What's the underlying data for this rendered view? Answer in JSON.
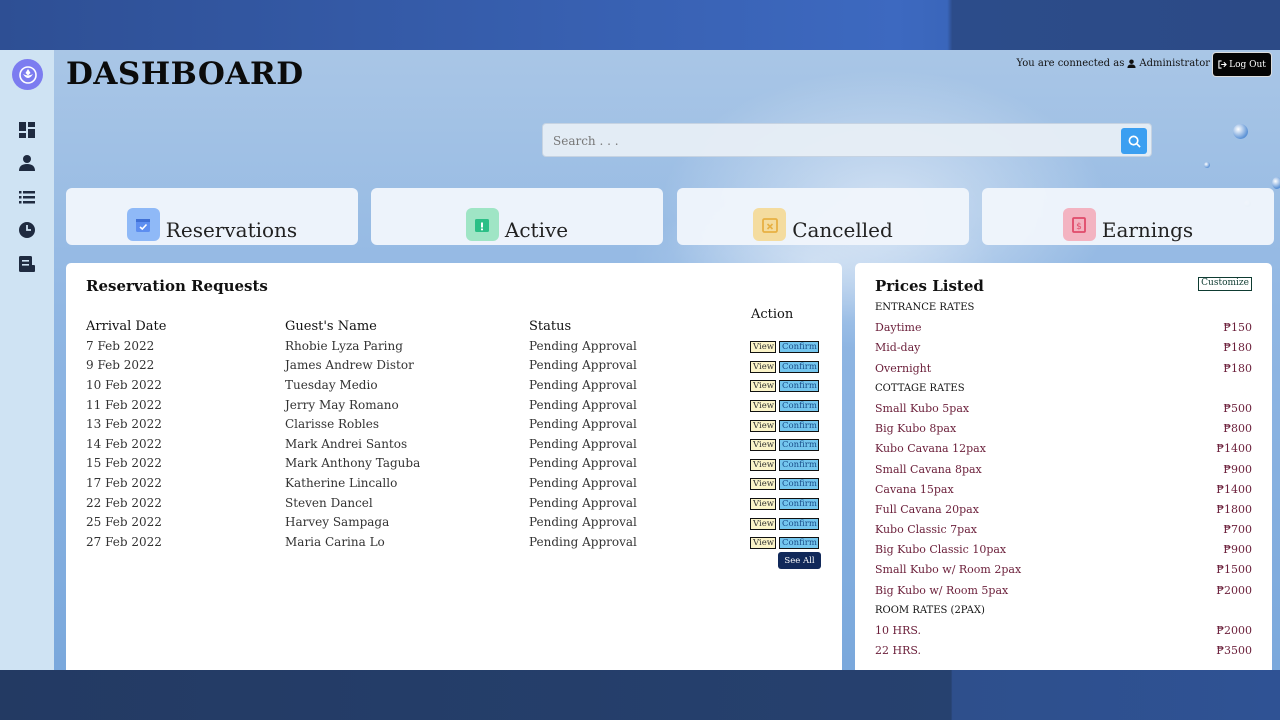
{
  "header": {
    "title": "DASHBOARD",
    "connected_prefix": "You are connected as",
    "user": "Administrator",
    "logout_label": "Log Out"
  },
  "search": {
    "placeholder": "Search . . ."
  },
  "stats": [
    {
      "label": "Reservations",
      "color": "#5d8ef0"
    },
    {
      "label": "Active",
      "color": "#2bbf86"
    },
    {
      "label": "Cancelled",
      "color": "#e7b043"
    },
    {
      "label": "Earnings",
      "color": "#e04a69"
    }
  ],
  "reservations": {
    "title": "Reservation Requests",
    "columns": {
      "date": "Arrival Date",
      "name": "Guest's Name",
      "status": "Status",
      "action": "Action"
    },
    "view_label": "View",
    "confirm_label": "Confirm",
    "see_all_label": "See All",
    "rows": [
      {
        "date": "7 Feb 2022",
        "name": "Rhobie Lyza Paring",
        "status": "Pending Approval"
      },
      {
        "date": "9 Feb 2022",
        "name": "James Andrew Distor",
        "status": "Pending Approval"
      },
      {
        "date": "10 Feb 2022",
        "name": "Tuesday Medio",
        "status": "Pending Approval"
      },
      {
        "date": "11 Feb 2022",
        "name": "Jerry May Romano",
        "status": "Pending Approval"
      },
      {
        "date": "13 Feb 2022",
        "name": "Clarisse Robles",
        "status": "Pending Approval"
      },
      {
        "date": "14 Feb 2022",
        "name": "Mark Andrei Santos",
        "status": "Pending Approval"
      },
      {
        "date": "15 Feb 2022",
        "name": "Mark Anthony Taguba",
        "status": "Pending Approval"
      },
      {
        "date": "17 Feb 2022",
        "name": "Katherine Lincallo",
        "status": "Pending Approval"
      },
      {
        "date": "22 Feb 2022",
        "name": "Steven Dancel",
        "status": "Pending Approval"
      },
      {
        "date": "25 Feb 2022",
        "name": "Harvey Sampaga",
        "status": "Pending Approval"
      },
      {
        "date": "27 Feb 2022",
        "name": "Maria Carina Lo",
        "status": "Pending Approval"
      }
    ]
  },
  "prices": {
    "title": "Prices Listed",
    "customize_label": "Customize",
    "sections": [
      {
        "heading": "ENTRANCE RATES",
        "items": [
          {
            "name": "Daytime",
            "price": "₱150"
          },
          {
            "name": "Mid-day",
            "price": "₱180"
          },
          {
            "name": "Overnight",
            "price": "₱180"
          }
        ]
      },
      {
        "heading": "COTTAGE RATES",
        "items": [
          {
            "name": "Small Kubo 5pax",
            "price": "₱500"
          },
          {
            "name": "Big Kubo 8pax",
            "price": "₱800"
          },
          {
            "name": "Kubo Cavana 12pax",
            "price": "₱1400"
          },
          {
            "name": "Small Cavana 8pax",
            "price": "₱900"
          },
          {
            "name": "Cavana 15pax",
            "price": "₱1400"
          },
          {
            "name": "Full Cavana 20pax",
            "price": "₱1800"
          },
          {
            "name": "Kubo Classic 7pax",
            "price": "₱700"
          },
          {
            "name": "Big Kubo Classic 10pax",
            "price": "₱900"
          },
          {
            "name": "Small Kubo w/ Room 2pax",
            "price": "₱1500"
          },
          {
            "name": "Big Kubo w/ Room 5pax",
            "price": "₱2000"
          }
        ]
      },
      {
        "heading": "ROOM RATES (2PAX)",
        "items": [
          {
            "name": "10 HRS.",
            "price": "₱2000"
          },
          {
            "name": "22 HRS.",
            "price": "₱3500"
          }
        ]
      }
    ]
  },
  "sidebar": {
    "items": [
      {
        "icon": "dashboard-icon"
      },
      {
        "icon": "user-icon"
      },
      {
        "icon": "list-icon"
      },
      {
        "icon": "clock-icon"
      },
      {
        "icon": "receipt-icon"
      }
    ]
  }
}
